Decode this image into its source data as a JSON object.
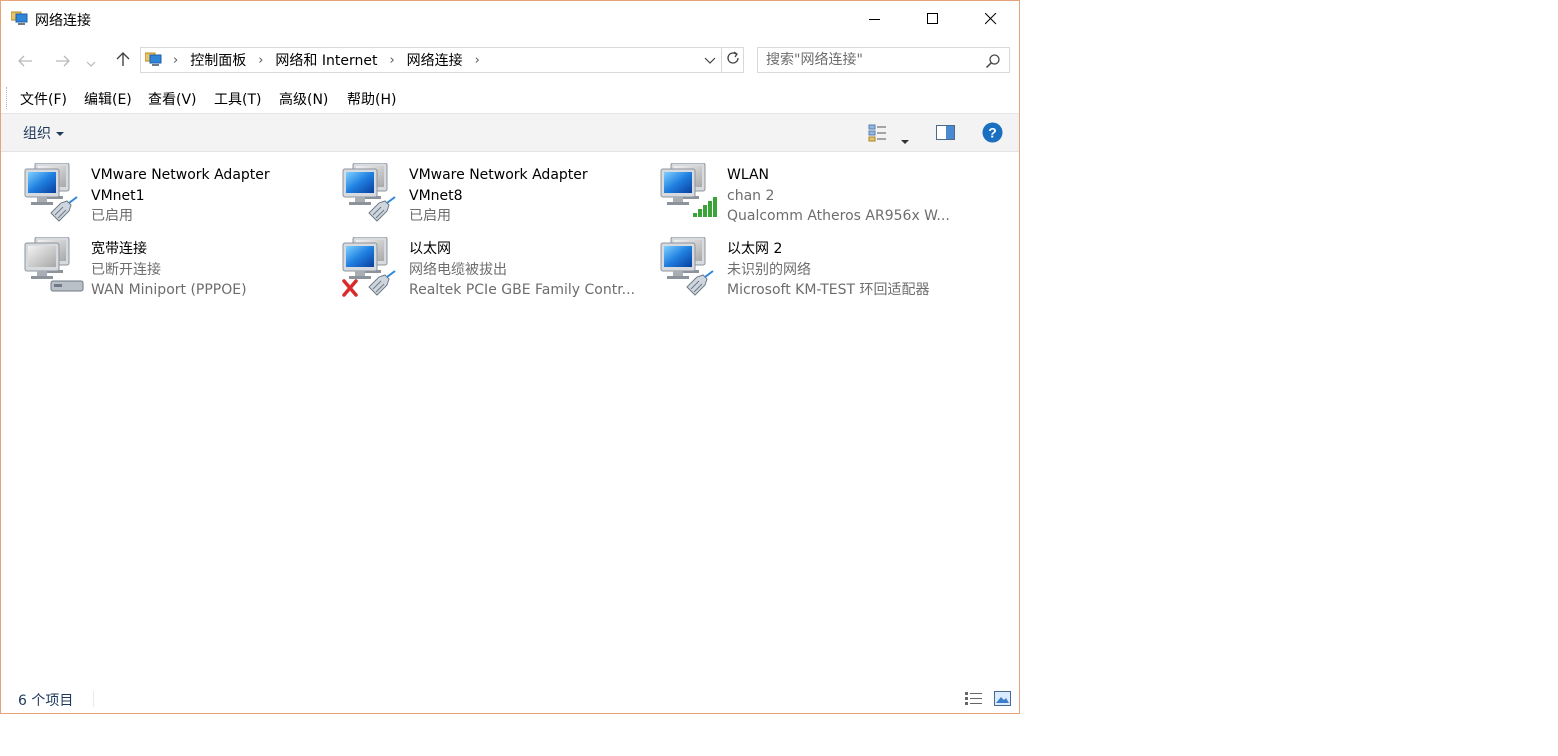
{
  "window": {
    "title": "网络连接",
    "minimize_icon": "minimize-icon",
    "maximize_icon": "maximize-icon",
    "close_icon": "close-icon"
  },
  "navigation": {
    "back_icon": "arrow-left-icon",
    "forward_icon": "arrow-right-icon",
    "recent_icon": "chevron-down-icon",
    "up_icon": "arrow-up-icon",
    "breadcrumbs": [
      "控制面板",
      "网络和 Internet",
      "网络连接"
    ],
    "refresh_icon": "refresh-icon",
    "search_placeholder": "搜索\"网络连接\""
  },
  "menu": {
    "items": [
      "文件(F)",
      "编辑(E)",
      "查看(V)",
      "工具(T)",
      "高级(N)",
      "帮助(H)"
    ]
  },
  "commandbar": {
    "organize_label": "组织",
    "view_icon": "change-view-icon",
    "preview_pane_icon": "preview-pane-icon",
    "help_icon": "help-icon"
  },
  "connections": [
    {
      "name_line1": "VMware Network Adapter",
      "name_line2": "VMnet1",
      "status": "已启用",
      "device": "",
      "icon": "ethernet-adapter-icon"
    },
    {
      "name_line1": "VMware Network Adapter",
      "name_line2": "VMnet8",
      "status": "已启用",
      "device": "",
      "icon": "ethernet-adapter-icon"
    },
    {
      "name_line1": "WLAN",
      "name_line2": "",
      "status": "chan  2",
      "device": "Qualcomm Atheros AR956x W...",
      "icon": "wireless-adapter-icon"
    },
    {
      "name_line1": "宽带连接",
      "name_line2": "",
      "status": "已断开连接",
      "device": "WAN Miniport (PPPOE)",
      "icon": "broadband-connection-icon"
    },
    {
      "name_line1": "以太网",
      "name_line2": "",
      "status": "网络电缆被拔出",
      "device": "Realtek PCIe GBE Family Contr...",
      "icon": "ethernet-unplugged-icon"
    },
    {
      "name_line1": "以太网 2",
      "name_line2": "",
      "status": "未识别的网络",
      "device": "Microsoft KM-TEST 环回适配器",
      "icon": "ethernet-adapter-icon"
    }
  ],
  "statusbar": {
    "item_count": "6 个项目",
    "details_view_icon": "details-view-icon",
    "large_icons_view_icon": "large-icons-view-icon"
  },
  "colors": {
    "window_border": "#e8a37a",
    "link_text": "#1e395b",
    "help_blue": "#1a6fc0",
    "secondary_text": "#6d6d6d"
  }
}
